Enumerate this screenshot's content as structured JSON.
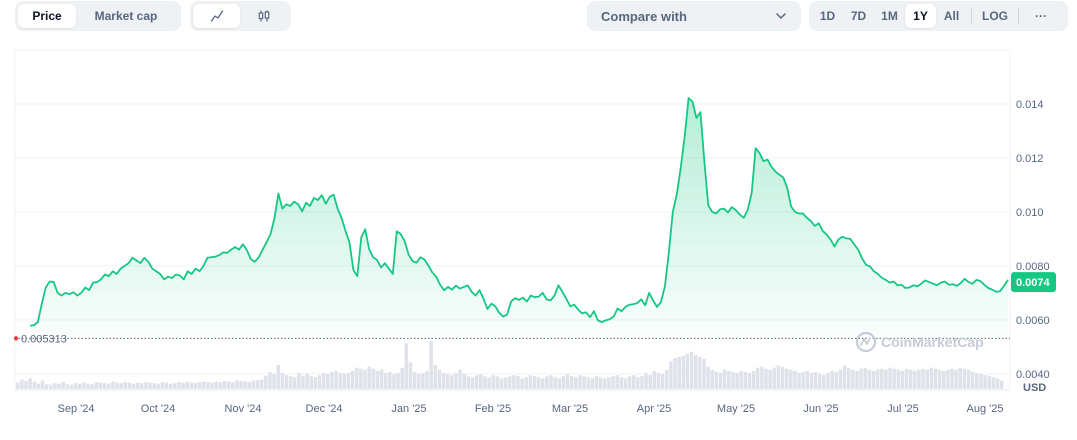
{
  "toolbar": {
    "type_options": [
      "Price",
      "Market cap"
    ],
    "active_type": "Price",
    "view_options": [
      {
        "icon": "line-chart-icon"
      },
      {
        "icon": "candlestick-icon"
      }
    ],
    "compare_label": "Compare with",
    "range_options": [
      "1D",
      "7D",
      "1M",
      "1Y",
      "All"
    ],
    "active_range": "1Y",
    "log_label": "LOG",
    "more_label": "···"
  },
  "watermark": "CoinMarketCap",
  "colors": {
    "line": "#16c784",
    "fill_top": "#16c784",
    "price_badge": "#16c784",
    "baseline_marker": "#ea3943"
  },
  "chart_data": {
    "type": "area",
    "x_tick_labels": [
      "Sep '24",
      "Oct '24",
      "Nov '24",
      "Dec '24",
      "Jan '25",
      "Feb '25",
      "Mar '25",
      "Apr '25",
      "May '25",
      "Jun '25",
      "Jul '25",
      "Aug '25"
    ],
    "y_ticks": [
      0.004,
      0.006,
      0.008,
      0.01,
      0.012,
      0.014
    ],
    "y_tick_labels": [
      "0.0040",
      "0.0060",
      "0.0080",
      "0.010",
      "0.012",
      "0.014"
    ],
    "ylim": [
      0.0034,
      0.016
    ],
    "current_price_label": "0.0074",
    "current_price": 0.0074,
    "baseline_label": "0.005313",
    "baseline": 0.005313,
    "volume_axis_label": "USD",
    "grid": true,
    "series": [
      {
        "values": [
          0.00578,
          0.0058,
          0.00592,
          0.0066,
          0.0072,
          0.00742,
          0.0074,
          0.007,
          0.0069,
          0.007,
          0.00695,
          0.00702,
          0.0069,
          0.007,
          0.0072,
          0.0071,
          0.00738,
          0.0074,
          0.0075,
          0.00768,
          0.00762,
          0.0078,
          0.0077,
          0.0079,
          0.008,
          0.0081,
          0.0083,
          0.0082,
          0.0081,
          0.0083,
          0.00815,
          0.0079,
          0.0078,
          0.0077,
          0.0075,
          0.0076,
          0.00755,
          0.00768,
          0.00764,
          0.0075,
          0.0078,
          0.0077,
          0.0079,
          0.0078,
          0.008,
          0.0083,
          0.00832,
          0.00834,
          0.0084,
          0.0085,
          0.00848,
          0.0086,
          0.0087,
          0.0086,
          0.0088,
          0.00858,
          0.00825,
          0.00815,
          0.00832,
          0.0086,
          0.00888,
          0.00918,
          0.00977,
          0.01068,
          0.01012,
          0.01028,
          0.01022,
          0.01038,
          0.01028,
          0.01002,
          0.01034,
          0.01022,
          0.01052,
          0.01044,
          0.01062,
          0.0103,
          0.01056,
          0.01064,
          0.01012,
          0.00978,
          0.0093,
          0.00888,
          0.00785,
          0.00762,
          0.00905,
          0.00936,
          0.00862,
          0.00832,
          0.00822,
          0.00794,
          0.0081,
          0.0079,
          0.0077,
          0.00928,
          0.00918,
          0.00892,
          0.00842,
          0.00818,
          0.00812,
          0.00832,
          0.00824,
          0.00802,
          0.00776,
          0.0076,
          0.0073,
          0.0071,
          0.00722,
          0.00712,
          0.00727,
          0.00716,
          0.00722,
          0.00728,
          0.00704,
          0.0069,
          0.0071,
          0.00678,
          0.0064,
          0.0066,
          0.0065,
          0.00626,
          0.00612,
          0.0062,
          0.00668,
          0.0068,
          0.00674,
          0.00682,
          0.00668,
          0.0069,
          0.00684,
          0.00686,
          0.007,
          0.00676,
          0.00672,
          0.0069,
          0.00728,
          0.00704,
          0.00678,
          0.0065,
          0.00656,
          0.00638,
          0.00624,
          0.00628,
          0.0061,
          0.00632,
          0.00598,
          0.00592,
          0.00598,
          0.00602,
          0.00612,
          0.00642,
          0.00632,
          0.00648,
          0.00656,
          0.00658,
          0.00662,
          0.00676,
          0.00654,
          0.007,
          0.00672,
          0.00648,
          0.00666,
          0.00724,
          0.0085,
          0.01,
          0.01064,
          0.01162,
          0.01278,
          0.01422,
          0.01408,
          0.01348,
          0.0137,
          0.01188,
          0.01024,
          0.01,
          0.00994,
          0.0101,
          0.01012,
          0.00998,
          0.01018,
          0.01006,
          0.0099,
          0.00978,
          0.01008,
          0.0107,
          0.01236,
          0.01218,
          0.01188,
          0.01194,
          0.01168,
          0.0115,
          0.01138,
          0.01128,
          0.0109,
          0.0102,
          0.01,
          0.00994,
          0.00994,
          0.00978,
          0.00966,
          0.00948,
          0.00958,
          0.0093,
          0.00916,
          0.00898,
          0.00872,
          0.00898,
          0.00908,
          0.00902,
          0.009,
          0.0088,
          0.0086,
          0.00828,
          0.00804,
          0.00798,
          0.0078,
          0.0077,
          0.00756,
          0.00748,
          0.00738,
          0.00742,
          0.00728,
          0.0073,
          0.00718,
          0.0072,
          0.00728,
          0.00724,
          0.00734,
          0.00746,
          0.0074,
          0.00734,
          0.00728,
          0.00738,
          0.00742,
          0.0073,
          0.00732,
          0.00726,
          0.00736,
          0.00752,
          0.0074,
          0.00734,
          0.00748,
          0.00744,
          0.0073,
          0.00718,
          0.00712,
          0.00704,
          0.00706,
          0.00726,
          0.00748
        ]
      }
    ],
    "volume_values": [
      0.12,
      0.18,
      0.15,
      0.2,
      0.14,
      0.1,
      0.16,
      0.09,
      0.08,
      0.11,
      0.1,
      0.13,
      0.09,
      0.08,
      0.11,
      0.1,
      0.12,
      0.1,
      0.09,
      0.13,
      0.12,
      0.11,
      0.1,
      0.14,
      0.12,
      0.11,
      0.13,
      0.12,
      0.1,
      0.12,
      0.11,
      0.13,
      0.12,
      0.11,
      0.1,
      0.13,
      0.12,
      0.1,
      0.11,
      0.13,
      0.12,
      0.14,
      0.12,
      0.11,
      0.13,
      0.14,
      0.13,
      0.12,
      0.14,
      0.13,
      0.15,
      0.14,
      0.13,
      0.16,
      0.15,
      0.14,
      0.13,
      0.16,
      0.17,
      0.18,
      0.25,
      0.32,
      0.28,
      0.45,
      0.3,
      0.26,
      0.24,
      0.22,
      0.3,
      0.25,
      0.28,
      0.24,
      0.22,
      0.26,
      0.3,
      0.28,
      0.32,
      0.34,
      0.3,
      0.28,
      0.3,
      0.34,
      0.4,
      0.38,
      0.36,
      0.42,
      0.38,
      0.34,
      0.36,
      0.3,
      0.32,
      0.28,
      0.3,
      0.4,
      0.86,
      0.5,
      0.32,
      0.28,
      0.3,
      0.34,
      0.9,
      0.45,
      0.36,
      0.3,
      0.28,
      0.26,
      0.3,
      0.36,
      0.28,
      0.24,
      0.22,
      0.26,
      0.28,
      0.24,
      0.22,
      0.26,
      0.24,
      0.2,
      0.22,
      0.24,
      0.26,
      0.24,
      0.2,
      0.22,
      0.26,
      0.24,
      0.22,
      0.2,
      0.24,
      0.26,
      0.22,
      0.2,
      0.24,
      0.28,
      0.24,
      0.22,
      0.26,
      0.24,
      0.22,
      0.2,
      0.24,
      0.22,
      0.2,
      0.22,
      0.24,
      0.26,
      0.22,
      0.2,
      0.24,
      0.26,
      0.22,
      0.24,
      0.3,
      0.26,
      0.34,
      0.3,
      0.28,
      0.36,
      0.52,
      0.58,
      0.6,
      0.62,
      0.66,
      0.7,
      0.64,
      0.6,
      0.56,
      0.42,
      0.36,
      0.32,
      0.3,
      0.36,
      0.34,
      0.32,
      0.3,
      0.34,
      0.32,
      0.3,
      0.34,
      0.4,
      0.42,
      0.38,
      0.36,
      0.4,
      0.44,
      0.42,
      0.38,
      0.36,
      0.34,
      0.3,
      0.32,
      0.34,
      0.3,
      0.32,
      0.28,
      0.26,
      0.3,
      0.34,
      0.32,
      0.36,
      0.44,
      0.4,
      0.36,
      0.34,
      0.38,
      0.4,
      0.36,
      0.34,
      0.36,
      0.38,
      0.36,
      0.4,
      0.38,
      0.36,
      0.34,
      0.38,
      0.36,
      0.34,
      0.36,
      0.38,
      0.36,
      0.4,
      0.38,
      0.36,
      0.34,
      0.36,
      0.38,
      0.36,
      0.4,
      0.38,
      0.36,
      0.32,
      0.3,
      0.28,
      0.26,
      0.24,
      0.22,
      0.2,
      0.16
    ]
  }
}
